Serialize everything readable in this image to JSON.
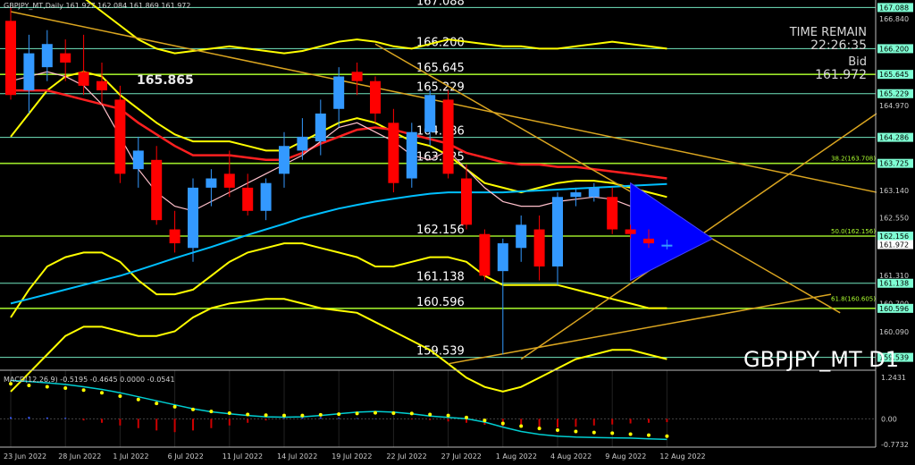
{
  "header": {
    "symbol_line": "GBPJPY_MT,Daily  161.927 162.084 161.869 161.972",
    "big_price": "165.865",
    "time_remain_label": "TIME REMAIN",
    "time_remain_value": "22:26:35",
    "bid_label": "Bid",
    "bid_value": "161.972",
    "watermark": "GBPJPY_MT D1"
  },
  "colors": {
    "background": "#000000",
    "bull": "#3399ff",
    "bear": "#ff0000",
    "level_line": "#7fffd4",
    "green_line": "#adff2f",
    "yellow": "#ffff00",
    "orange": "#daa520",
    "cyan_ma": "#00bfff",
    "red_ma": "#ff2020",
    "pink_ma": "#ffc0cb",
    "triangle": "#0000ff",
    "macd_signal": "#00ced1",
    "macd_hist": "#cc0000"
  },
  "chart_data": {
    "type": "candlestick",
    "symbol": "GBPJPY_MT",
    "timeframe": "Daily",
    "ylim": [
      159.3,
      167.25
    ],
    "x_tick_labels": [
      {
        "date": "23 Jun 2022",
        "index": 0
      },
      {
        "date": "28 Jun 2022",
        "index": 3
      },
      {
        "date": "1 Jul 2022",
        "index": 6
      },
      {
        "date": "6 Jul 2022",
        "index": 9
      },
      {
        "date": "11 Jul 2022",
        "index": 12
      },
      {
        "date": "14 Jul 2022",
        "index": 15
      },
      {
        "date": "19 Jul 2022",
        "index": 18
      },
      {
        "date": "22 Jul 2022",
        "index": 21
      },
      {
        "date": "27 Jul 2022",
        "index": 24
      },
      {
        "date": "1 Aug 2022",
        "index": 27
      },
      {
        "date": "4 Aug 2022",
        "index": 30
      },
      {
        "date": "9 Aug 2022",
        "index": 33
      },
      {
        "date": "12 Aug 2022",
        "index": 36
      }
    ],
    "y_tick_labels": [
      {
        "value": 167.088,
        "label": "167.088",
        "hl": true
      },
      {
        "value": 166.84,
        "label": "166.840",
        "hl": false
      },
      {
        "value": 166.2,
        "label": "166.200",
        "hl": true
      },
      {
        "value": 165.645,
        "label": "165.645",
        "hl": true
      },
      {
        "value": 165.229,
        "label": "165.229",
        "hl": true
      },
      {
        "value": 164.97,
        "label": "164.970",
        "hl": false
      },
      {
        "value": 164.286,
        "label": "164.286",
        "hl": true
      },
      {
        "value": 163.725,
        "label": "163.725",
        "hl": true
      },
      {
        "value": 163.14,
        "label": "163.140",
        "hl": false
      },
      {
        "value": 162.55,
        "label": "162.550",
        "hl": false
      },
      {
        "value": 162.156,
        "label": "162.156",
        "hl": true
      },
      {
        "value": 161.972,
        "label": "161.972",
        "hl": true
      },
      {
        "value": 161.31,
        "label": "161.310",
        "hl": false
      },
      {
        "value": 161.138,
        "label": "161.138",
        "hl": true
      },
      {
        "value": 160.7,
        "label": "160.700",
        "hl": false
      },
      {
        "value": 160.596,
        "label": "160.596",
        "hl": true
      },
      {
        "value": 160.09,
        "label": "160.090",
        "hl": false
      },
      {
        "value": 159.539,
        "label": "159.539",
        "hl": true
      }
    ],
    "level_lines": [
      {
        "value": 167.088,
        "label": "167.088",
        "style": "cyan"
      },
      {
        "value": 166.2,
        "label": "166.200",
        "style": "cyan"
      },
      {
        "value": 165.645,
        "label": "165.645",
        "style": "green"
      },
      {
        "value": 165.229,
        "label": "165.229",
        "style": "cyan"
      },
      {
        "value": 164.286,
        "label": "164.286",
        "style": "cyan"
      },
      {
        "value": 163.725,
        "label": "163.725",
        "style": "green"
      },
      {
        "value": 162.156,
        "label": "162.156",
        "style": "green"
      },
      {
        "value": 161.138,
        "label": "161.138",
        "style": "cyan"
      },
      {
        "value": 160.596,
        "label": "160.596",
        "style": "green"
      },
      {
        "value": 159.539,
        "label": "159.539",
        "style": "cyan"
      }
    ],
    "fib_labels": [
      {
        "value": 163.725,
        "label": "38.2(163.708)"
      },
      {
        "value": 162.156,
        "label": "50.0(162.156)"
      },
      {
        "value": 160.7,
        "label": "61.8(160.605)"
      }
    ],
    "candles": [
      {
        "o": 166.8,
        "h": 167.1,
        "l": 165.1,
        "c": 165.2
      },
      {
        "o": 165.3,
        "h": 166.5,
        "l": 164.8,
        "c": 166.1
      },
      {
        "o": 165.8,
        "h": 166.6,
        "l": 165.5,
        "c": 166.3
      },
      {
        "o": 166.1,
        "h": 166.4,
        "l": 165.5,
        "c": 165.9
      },
      {
        "o": 165.7,
        "h": 166.5,
        "l": 165.2,
        "c": 165.4
      },
      {
        "o": 165.5,
        "h": 165.9,
        "l": 165.0,
        "c": 165.3
      },
      {
        "o": 165.1,
        "h": 165.4,
        "l": 163.3,
        "c": 163.5
      },
      {
        "o": 163.6,
        "h": 164.3,
        "l": 163.2,
        "c": 164.0
      },
      {
        "o": 163.8,
        "h": 164.1,
        "l": 162.4,
        "c": 162.5
      },
      {
        "o": 162.3,
        "h": 162.7,
        "l": 161.8,
        "c": 162.0
      },
      {
        "o": 161.9,
        "h": 163.4,
        "l": 161.6,
        "c": 163.2
      },
      {
        "o": 163.2,
        "h": 163.6,
        "l": 162.8,
        "c": 163.4
      },
      {
        "o": 163.5,
        "h": 164.0,
        "l": 163.0,
        "c": 163.2
      },
      {
        "o": 163.2,
        "h": 163.5,
        "l": 162.6,
        "c": 162.7
      },
      {
        "o": 162.7,
        "h": 163.4,
        "l": 162.5,
        "c": 163.3
      },
      {
        "o": 163.5,
        "h": 164.4,
        "l": 163.2,
        "c": 164.1
      },
      {
        "o": 164.0,
        "h": 164.7,
        "l": 163.8,
        "c": 164.3
      },
      {
        "o": 164.2,
        "h": 165.1,
        "l": 163.9,
        "c": 164.8
      },
      {
        "o": 164.9,
        "h": 165.8,
        "l": 164.5,
        "c": 165.6
      },
      {
        "o": 165.7,
        "h": 165.9,
        "l": 165.2,
        "c": 165.5
      },
      {
        "o": 165.5,
        "h": 165.6,
        "l": 164.6,
        "c": 164.8
      },
      {
        "o": 164.6,
        "h": 164.9,
        "l": 163.1,
        "c": 163.3
      },
      {
        "o": 163.4,
        "h": 164.6,
        "l": 163.2,
        "c": 164.4
      },
      {
        "o": 164.4,
        "h": 165.3,
        "l": 164.1,
        "c": 165.2
      },
      {
        "o": 165.1,
        "h": 165.3,
        "l": 163.4,
        "c": 163.5
      },
      {
        "o": 163.4,
        "h": 163.7,
        "l": 162.3,
        "c": 162.4
      },
      {
        "o": 162.2,
        "h": 162.3,
        "l": 161.2,
        "c": 161.3
      },
      {
        "o": 161.4,
        "h": 162.1,
        "l": 159.6,
        "c": 162.0
      },
      {
        "o": 161.9,
        "h": 162.6,
        "l": 161.6,
        "c": 162.4
      },
      {
        "o": 162.3,
        "h": 162.6,
        "l": 161.2,
        "c": 161.5
      },
      {
        "o": 161.5,
        "h": 163.1,
        "l": 161.1,
        "c": 163.0
      },
      {
        "o": 163.0,
        "h": 163.2,
        "l": 162.8,
        "c": 163.1
      },
      {
        "o": 163.0,
        "h": 163.3,
        "l": 162.9,
        "c": 163.2
      },
      {
        "o": 163.0,
        "h": 163.2,
        "l": 162.2,
        "c": 162.3
      },
      {
        "o": 162.3,
        "h": 162.4,
        "l": 162.1,
        "c": 162.2
      },
      {
        "o": 162.1,
        "h": 162.3,
        "l": 161.9,
        "c": 162.0
      },
      {
        "o": 161.93,
        "h": 162.08,
        "l": 161.87,
        "c": 161.97
      }
    ],
    "indicators": {
      "red_ma": [
        165.3,
        165.3,
        165.3,
        165.2,
        165.1,
        165.0,
        164.9,
        164.6,
        164.35,
        164.1,
        163.9,
        163.9,
        163.9,
        163.85,
        163.8,
        163.8,
        163.95,
        164.15,
        164.3,
        164.45,
        164.5,
        164.45,
        164.35,
        164.25,
        164.15,
        163.95,
        163.85,
        163.75,
        163.7,
        163.7,
        163.65,
        163.65,
        163.6,
        163.55,
        163.5,
        163.45,
        163.4
      ],
      "cyan_ma": [
        160.7,
        160.8,
        160.9,
        161.0,
        161.1,
        161.2,
        161.3,
        161.42,
        161.55,
        161.68,
        161.8,
        161.92,
        162.05,
        162.18,
        162.3,
        162.42,
        162.55,
        162.65,
        162.75,
        162.83,
        162.9,
        162.96,
        163.02,
        163.07,
        163.1,
        163.1,
        163.1,
        163.1,
        163.12,
        163.14,
        163.16,
        163.18,
        163.2,
        163.22,
        163.24,
        163.26,
        163.28
      ],
      "pink_ma": [
        165.5,
        165.6,
        165.7,
        165.6,
        165.4,
        165.0,
        164.3,
        163.6,
        163.1,
        162.8,
        162.7,
        162.9,
        163.1,
        163.3,
        163.5,
        163.7,
        163.9,
        164.2,
        164.5,
        164.6,
        164.4,
        164.2,
        163.9,
        163.8,
        164.0,
        163.6,
        163.2,
        162.9,
        162.8,
        162.8,
        162.9,
        162.95,
        163.0,
        162.95,
        162.8,
        162.6,
        162.5
      ],
      "bb_upper": [
        164.3,
        164.8,
        165.3,
        165.6,
        165.7,
        165.6,
        165.2,
        164.9,
        164.6,
        164.35,
        164.2,
        164.2,
        164.2,
        164.1,
        164.0,
        164.0,
        164.2,
        164.4,
        164.6,
        164.7,
        164.6,
        164.4,
        164.2,
        164.1,
        163.9,
        163.6,
        163.3,
        163.2,
        163.1,
        163.2,
        163.3,
        163.35,
        163.35,
        163.3,
        163.2,
        163.1,
        163.0
      ],
      "bb_lower": [
        160.4,
        161.0,
        161.5,
        161.7,
        161.8,
        161.8,
        161.6,
        161.2,
        160.9,
        160.9,
        161.0,
        161.3,
        161.6,
        161.8,
        161.9,
        162.0,
        162.0,
        161.9,
        161.8,
        161.7,
        161.5,
        161.5,
        161.6,
        161.7,
        161.7,
        161.6,
        161.3,
        161.1,
        161.1,
        161.1,
        161.1,
        161.0,
        160.9,
        160.8,
        160.7,
        160.6,
        160.6
      ],
      "bb2_upper": [
        167.3,
        167.4,
        167.6,
        167.5,
        167.3,
        167.0,
        166.7,
        166.4,
        166.2,
        166.1,
        166.15,
        166.2,
        166.25,
        166.2,
        166.15,
        166.1,
        166.15,
        166.25,
        166.35,
        166.4,
        166.35,
        166.25,
        166.2,
        166.3,
        166.4,
        166.35,
        166.3,
        166.25,
        166.25,
        166.2,
        166.2,
        166.25,
        166.3,
        166.35,
        166.3,
        166.25,
        166.2
      ],
      "bb2_lower": [
        158.8,
        159.2,
        159.6,
        160.0,
        160.2,
        160.2,
        160.1,
        160.0,
        160.0,
        160.1,
        160.4,
        160.6,
        160.7,
        160.75,
        160.8,
        160.8,
        160.7,
        160.6,
        160.55,
        160.5,
        160.3,
        160.1,
        159.9,
        159.7,
        159.4,
        159.1,
        158.9,
        158.8,
        158.9,
        159.1,
        159.3,
        159.5,
        159.6,
        159.7,
        159.7,
        159.6,
        159.5
      ]
    },
    "macd": {
      "label": "MACD(12,26,9) -0.5195 -0.4645 0.0000 -0.0541",
      "ylim": [
        -0.85,
        1.35
      ],
      "ticks": [
        {
          "value": 1.2431,
          "label": "1.2431"
        },
        {
          "value": 0.0,
          "label": "0.00"
        },
        {
          "value": -0.7732,
          "label": "-0.7732"
        }
      ],
      "signal": [
        1.15,
        1.12,
        1.08,
        1.03,
        0.96,
        0.88,
        0.78,
        0.66,
        0.54,
        0.42,
        0.3,
        0.21,
        0.15,
        0.1,
        0.06,
        0.05,
        0.06,
        0.1,
        0.15,
        0.2,
        0.22,
        0.2,
        0.15,
        0.08,
        0.04,
        0.0,
        -0.1,
        -0.25,
        -0.38,
        -0.47,
        -0.52,
        -0.55,
        -0.56,
        -0.57,
        -0.58,
        -0.6,
        -0.62
      ],
      "dots": [
        1.05,
        1.0,
        0.96,
        0.92,
        0.86,
        0.78,
        0.68,
        0.58,
        0.46,
        0.36,
        0.28,
        0.22,
        0.17,
        0.13,
        0.11,
        0.1,
        0.1,
        0.12,
        0.14,
        0.16,
        0.18,
        0.17,
        0.16,
        0.13,
        0.1,
        0.04,
        -0.05,
        -0.14,
        -0.22,
        -0.29,
        -0.34,
        -0.38,
        -0.41,
        -0.43,
        -0.46,
        -0.49,
        -0.52
      ],
      "hist": [
        0.05,
        0.06,
        0.04,
        0.03,
        -0.05,
        -0.12,
        -0.2,
        -0.28,
        -0.35,
        -0.4,
        -0.35,
        -0.28,
        -0.2,
        -0.12,
        -0.05,
        0.02,
        0.04,
        0.05,
        0.03,
        0.02,
        0.01,
        0.0,
        -0.02,
        -0.04,
        -0.08,
        -0.12,
        -0.18,
        -0.22,
        -0.25,
        -0.27,
        -0.26,
        -0.24,
        -0.2,
        -0.17,
        -0.14,
        -0.12,
        -0.1
      ]
    }
  }
}
